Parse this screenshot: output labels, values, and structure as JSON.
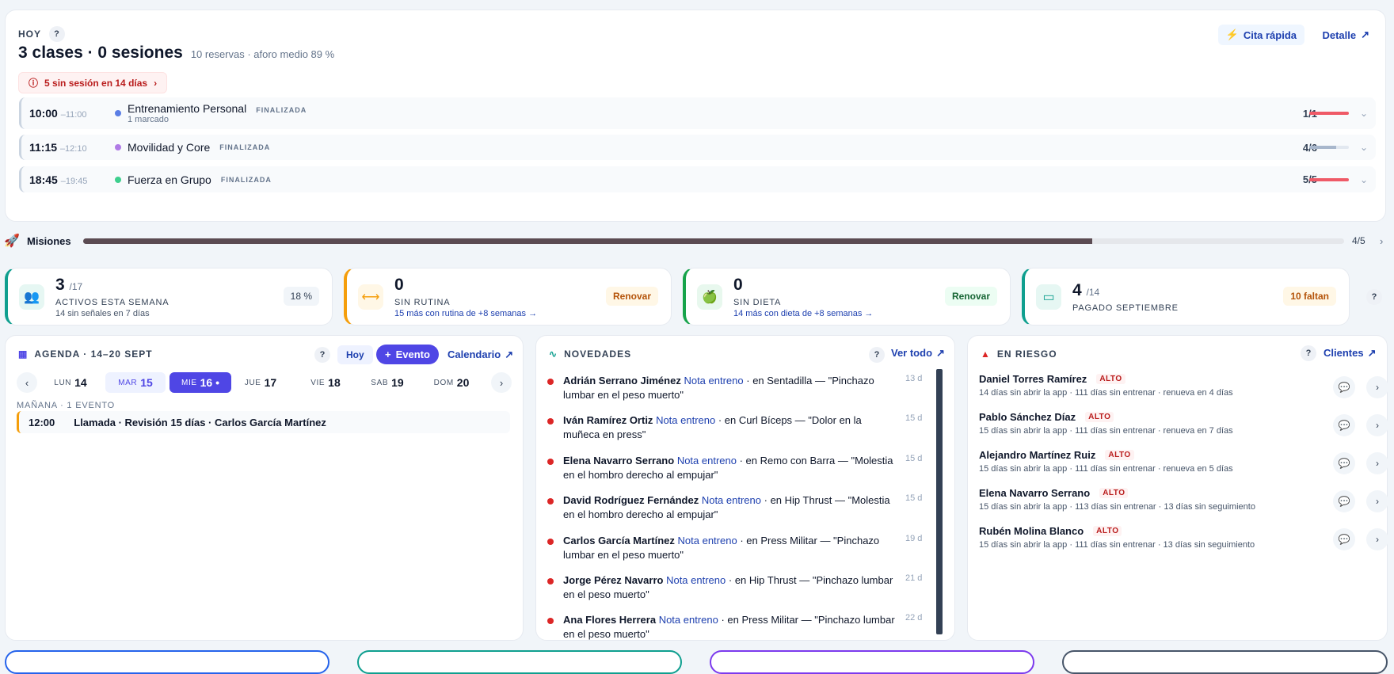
{
  "today": {
    "label": "HOY",
    "title": "3 clases · 0 sesiones",
    "subtitle": "10 reservas · aforo medio 89 %",
    "alert": "5 sin sesión en 14 días",
    "quick": "Cita rápida",
    "detail": "Detalle",
    "classes": [
      {
        "start": "10:00",
        "end": "–11:00",
        "name": "Entrenamiento Personal",
        "status": "FINALIZADA",
        "sub": "1 marcado",
        "count": "1/1",
        "fill": 1.0,
        "color": "#5b7ee5",
        "bar": "#ef5a67"
      },
      {
        "start": "11:15",
        "end": "–12:10",
        "name": "Movilidad y Core",
        "status": "FINALIZADA",
        "sub": "",
        "count": "4/6",
        "fill": 0.67,
        "color": "#b07be6",
        "bar": "#a8b7cc"
      },
      {
        "start": "18:45",
        "end": "–19:45",
        "name": "Fuerza en Grupo",
        "status": "FINALIZADA",
        "sub": "",
        "count": "5/5",
        "fill": 1.0,
        "color": "#3ecf8e",
        "bar": "#ef5a67"
      }
    ]
  },
  "missions": {
    "label": "Misiones",
    "value": "4/5",
    "progress": 0.8
  },
  "kpis": [
    {
      "big": "3",
      "of": "/17",
      "label": "ACTIVOS ESTA SEMANA",
      "sub": "14 sin señales en 7 días",
      "tag": "18 %",
      "icon": "users-icon",
      "accent": "#0f9f8f"
    },
    {
      "big": "0",
      "of": "",
      "label": "SIN RUTINA",
      "sub": "15 más con rutina de +8 semanas →",
      "tag": "Renovar",
      "icon": "dumbbell-icon",
      "accent": "#f59e0b"
    },
    {
      "big": "0",
      "of": "",
      "label": "SIN DIETA",
      "sub": "14 más con dieta de +8 semanas →",
      "tag": "Renovar",
      "icon": "apple-icon",
      "accent": "#16a34a"
    },
    {
      "big": "4",
      "of": "/14",
      "label": "PAGADO SEPTIEMBRE",
      "sub": "",
      "tag": "10 faltan",
      "icon": "card-icon",
      "accent": "#0f9f8f"
    }
  ],
  "agenda": {
    "title": "AGENDA · 14–20 SEPT",
    "today_btn": "Hoy",
    "event_btn": "Evento",
    "calendar": "Calendario",
    "days": [
      {
        "d": "LUN",
        "n": "14"
      },
      {
        "d": "MAR",
        "n": "15"
      },
      {
        "d": "MIE",
        "n": "16 •"
      },
      {
        "d": "JUE",
        "n": "17"
      },
      {
        "d": "VIE",
        "n": "18"
      },
      {
        "d": "SAB",
        "n": "19"
      },
      {
        "d": "DOM",
        "n": "20"
      }
    ],
    "section": "MAÑANA · 1 EVENTO",
    "event": {
      "time": "12:00",
      "title": "Llamada · Revisión 15 días · Carlos García Martínez"
    }
  },
  "novedades": {
    "title": "NOVEDADES",
    "link": "Ver todo",
    "items": [
      {
        "who": "Adrián Serrano Jiménez",
        "kind": "Nota entreno",
        "rest": "· en Sentadilla — \"Pinchazo lumbar en el peso muerto\"",
        "ago": "13 d"
      },
      {
        "who": "Iván Ramírez Ortiz",
        "kind": "Nota entreno",
        "rest": "· en Curl Bíceps — \"Dolor en la muñeca en press\"",
        "ago": "15 d"
      },
      {
        "who": "Elena Navarro Serrano",
        "kind": "Nota entreno",
        "rest": "· en Remo con Barra — \"Molestia en el hombro derecho al empujar\"",
        "ago": "15 d"
      },
      {
        "who": "David Rodríguez Fernández",
        "kind": "Nota entreno",
        "rest": "· en Hip Thrust — \"Molestia en el hombro derecho al empujar\"",
        "ago": "15 d"
      },
      {
        "who": "Carlos García Martínez",
        "kind": "Nota entreno",
        "rest": "· en Press Militar — \"Pinchazo lumbar en el peso muerto\"",
        "ago": "19 d"
      },
      {
        "who": "Jorge Pérez Navarro",
        "kind": "Nota entreno",
        "rest": "· en Hip Thrust — \"Pinchazo lumbar en el peso muerto\"",
        "ago": "21 d"
      },
      {
        "who": "Ana Flores Herrera",
        "kind": "Nota entreno",
        "rest": "· en Press Militar — \"Pinchazo lumbar en el peso muerto\"",
        "ago": "22 d"
      }
    ]
  },
  "risk": {
    "title": "EN RIESGO",
    "link": "Clientes",
    "items": [
      {
        "name": "Daniel Torres Ramírez",
        "level": "ALTO",
        "desc": "14 días sin abrir la app · 111 días sin entrenar · renueva en 4 días"
      },
      {
        "name": "Pablo Sánchez Díaz",
        "level": "ALTO",
        "desc": "15 días sin abrir la app · 111 días sin entrenar · renueva en 7 días"
      },
      {
        "name": "Alejandro Martínez Ruiz",
        "level": "ALTO",
        "desc": "15 días sin abrir la app · 111 días sin entrenar · renueva en 5 días"
      },
      {
        "name": "Elena Navarro Serrano",
        "level": "ALTO",
        "desc": "15 días sin abrir la app · 113 días sin entrenar · 13 días sin seguimiento"
      },
      {
        "name": "Rubén Molina Blanco",
        "level": "ALTO",
        "desc": "15 días sin abrir la app · 111 días sin entrenar · 13 días sin seguimiento"
      }
    ]
  }
}
